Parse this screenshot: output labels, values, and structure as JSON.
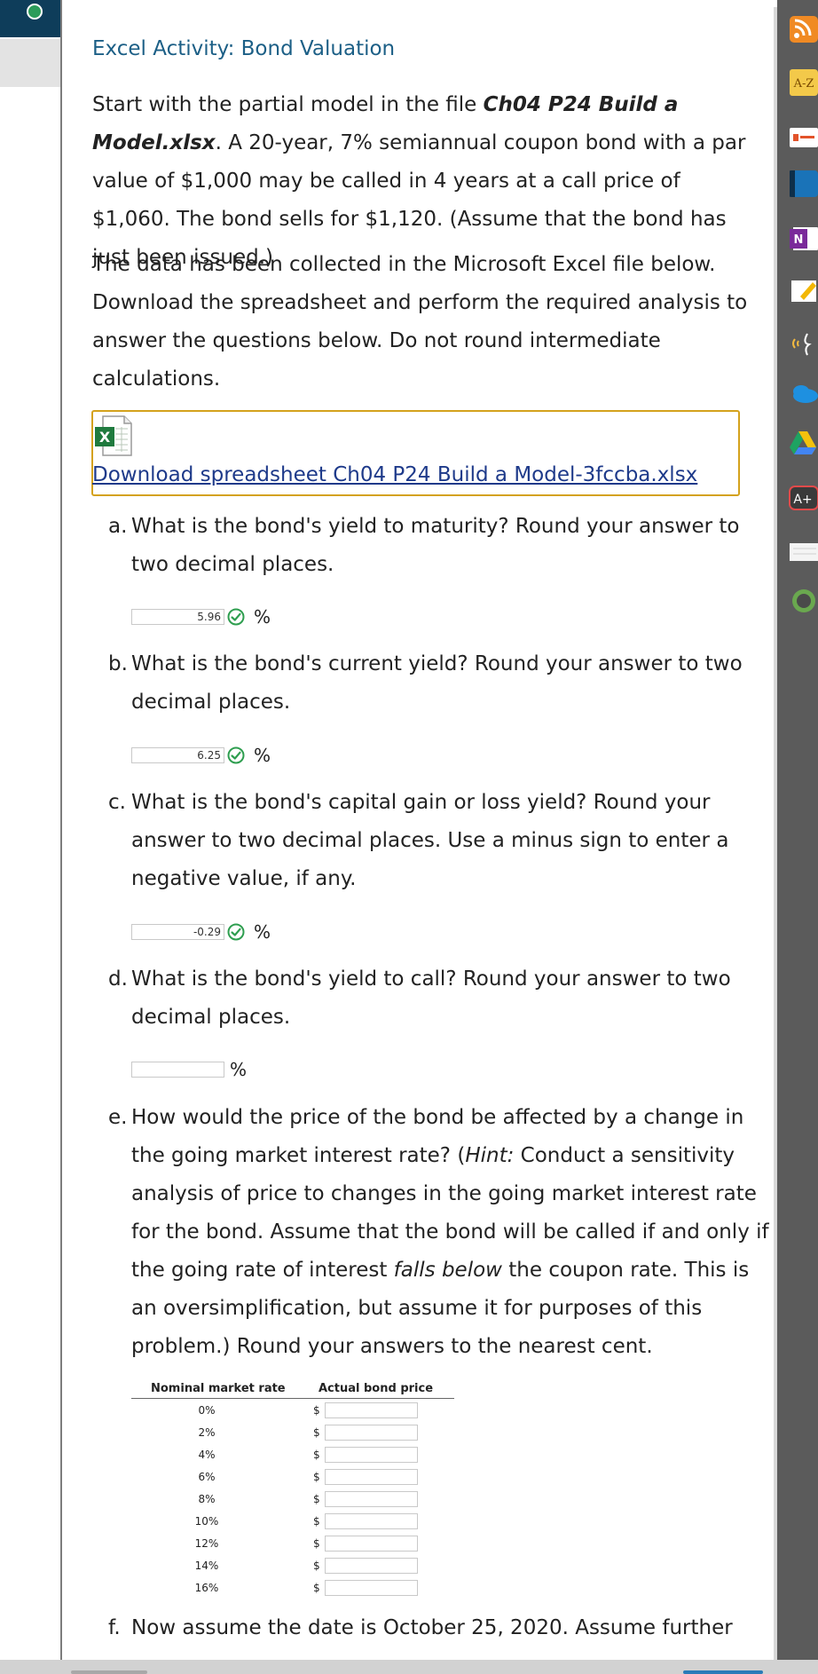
{
  "activity": {
    "title": "Excel Activity: Bond Valuation",
    "intro_prefix": "Start with the partial model in the file ",
    "intro_filename": "Ch04 P24 Build a Model.xlsx",
    "intro_suffix": ". A 20-year, 7% semiannual coupon bond with a par value of $1,000 may be called in 4 years at a call price of $1,060. The bond sells for $1,120. (Assume that the bond has just been issued.)",
    "data_note": "The data has been collected in the Microsoft Excel file below. Download the spreadsheet and perform the required analysis to answer the questions below. Do not round intermediate calculations.",
    "download_label": "Download spreadsheet Ch04 P24 Build a Model-3fccba.xlsx",
    "file_icon_letter": "X"
  },
  "questions": {
    "a": {
      "label": "a.",
      "text": "What is the bond's yield to maturity? Round your answer to two decimal places.",
      "answer": "5.96",
      "unit": "%"
    },
    "b": {
      "label": "b.",
      "text": "What is the bond's current yield? Round your answer to two decimal places.",
      "answer": "6.25",
      "unit": "%"
    },
    "c": {
      "label": "c.",
      "text": "What is the bond's capital gain or loss yield? Round your answer to two decimal places. Use a minus sign to enter a negative value, if any.",
      "answer": "-0.29",
      "unit": "%"
    },
    "d": {
      "label": "d.",
      "text": "What is the bond's yield to call? Round your answer to two decimal places.",
      "answer": "",
      "unit": "%"
    },
    "e": {
      "label": "e.",
      "text_1": "How would the price of the bond be affected by a change in the going market interest rate? (",
      "hint": "Hint:",
      "text_2": " Conduct a sensitivity analysis of price to changes in the going market interest rate for the bond. Assume that the bond will be called if and only if the going rate of interest ",
      "emph": "falls below",
      "text_3": " the coupon rate. This is an oversimplification, but assume it for purposes of this problem.) Round your answers to the nearest cent."
    },
    "f": {
      "label": "f.",
      "text": "Now assume the date is October 25, 2020. Assume further"
    }
  },
  "table": {
    "col_rate": "Nominal market rate",
    "col_price": "Actual bond price",
    "currency": "$",
    "rows": [
      "0%",
      "2%",
      "4%",
      "6%",
      "8%",
      "10%",
      "12%",
      "14%",
      "16%"
    ]
  },
  "colors": {
    "title": "#1c5f86",
    "link": "#1e3a8a",
    "highlight_border": "#d4a21d",
    "check": "#2e9e4f",
    "dock": "#5b5b5b"
  },
  "dock_icons": [
    "rss-icon",
    "az-dictionary-icon",
    "office-icon",
    "book-icon",
    "onenote-icon",
    "sticky-note-icon",
    "audio-icon",
    "onedrive-icon",
    "google-drive-icon",
    "grade-icon",
    "notepad-icon",
    "circle-app-icon"
  ]
}
